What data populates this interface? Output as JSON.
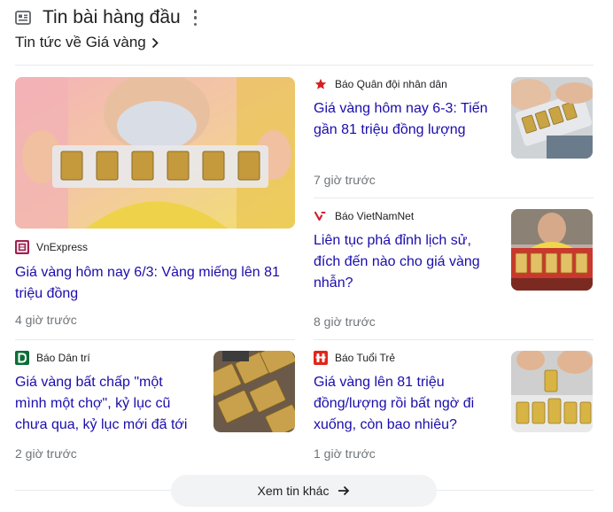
{
  "header": {
    "title": "Tin bài hàng đầu",
    "icon": "news-icon",
    "menu_icon": "more-vert-icon"
  },
  "subheader": {
    "label": "Tin tức về Giá vàng",
    "icon": "chevron-right-icon"
  },
  "featured": {
    "source": "VnExpress",
    "source_color": "#9f224e",
    "headline": "Giá vàng hôm nay 6/3: Vàng miếng lên 81 triệu đồng",
    "time": "4 giờ trước"
  },
  "stories": [
    {
      "source": "Báo Quân đội nhân dân",
      "source_icon": "red-star-icon",
      "headline": "Giá vàng hôm nay 6-3: Tiến gần 81 triệu đồng lượng",
      "time": "7 giờ trước"
    },
    {
      "source": "Báo VietNamNet",
      "source_icon": "vietnamnet-logo-icon",
      "headline": "Liên tục phá đỉnh lịch sử, đích đến nào cho giá vàng nhẫn?",
      "time": "8 giờ trước"
    },
    {
      "source": "Báo Dân trí",
      "source_icon": "dantri-logo-icon",
      "source_color": "#0c6d34",
      "headline": "Giá vàng bất chấp \"một mình một chợ\", kỷ lục cũ chưa qua, kỷ lục mới đã tới",
      "time": "2 giờ trước"
    },
    {
      "source": "Báo Tuổi Trẻ",
      "source_icon": "tuoitre-logo-icon",
      "source_color": "#e0261b",
      "headline": "Giá vàng lên 81 triệu đồng/lượng rồi bất ngờ đi xuống, còn bao nhiêu?",
      "time": "1 giờ trước"
    }
  ],
  "more_button": {
    "label": "Xem tin khác",
    "icon": "arrow-right-icon"
  },
  "colors": {
    "link": "#1a0dab",
    "meta": "#70757a",
    "divider": "#e8eaed",
    "gold": "#d4b25a"
  }
}
